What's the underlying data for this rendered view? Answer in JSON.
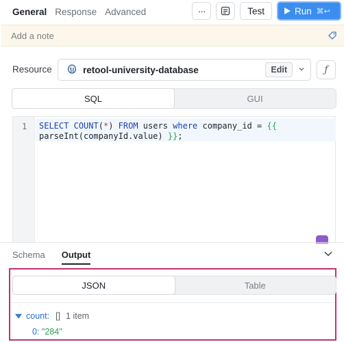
{
  "header": {
    "tabs": [
      {
        "label": "General",
        "active": true
      },
      {
        "label": "Response",
        "active": false
      },
      {
        "label": "Advanced",
        "active": false
      }
    ],
    "more_label": "···",
    "test_label": "Test",
    "run_label": "Run",
    "run_shortcut": "⌘↩"
  },
  "note": {
    "placeholder": "Add a note"
  },
  "resource": {
    "label": "Resource",
    "name": "retool-university-database",
    "edit_label": "Edit",
    "fx_label": "ƒ"
  },
  "mode_toggle": {
    "options": [
      "SQL",
      "GUI"
    ],
    "selected": "SQL"
  },
  "editor": {
    "line_number": "1",
    "code": {
      "kw_select": "SELECT",
      "fn_count": "COUNT",
      "paren_open": "(",
      "star": "*",
      "paren_close": ")",
      "kw_from": "FROM",
      "table": "users",
      "kw_where": "where",
      "column": "company_id",
      "eq": "=",
      "brace_open": "{{",
      "expr_fn": "parseInt",
      "expr_paren_open": "(",
      "expr_arg": "companyId.value",
      "expr_paren_close": ")",
      "brace_close": "}}",
      "semicolon": ";"
    }
  },
  "output_panel": {
    "tabs": [
      {
        "label": "Schema",
        "active": false
      },
      {
        "label": "Output",
        "active": true
      }
    ],
    "view_toggle": {
      "options": [
        "JSON",
        "Table"
      ],
      "selected": "JSON"
    },
    "json_tree": {
      "key": "count:",
      "bracket": "[]",
      "summary": "1 item",
      "items": [
        {
          "index": "0:",
          "value": "\"284\""
        }
      ]
    }
  },
  "colors": {
    "accent": "#3b8df0",
    "highlight_border": "#c32f73",
    "note_bg": "#fcf7ea"
  }
}
